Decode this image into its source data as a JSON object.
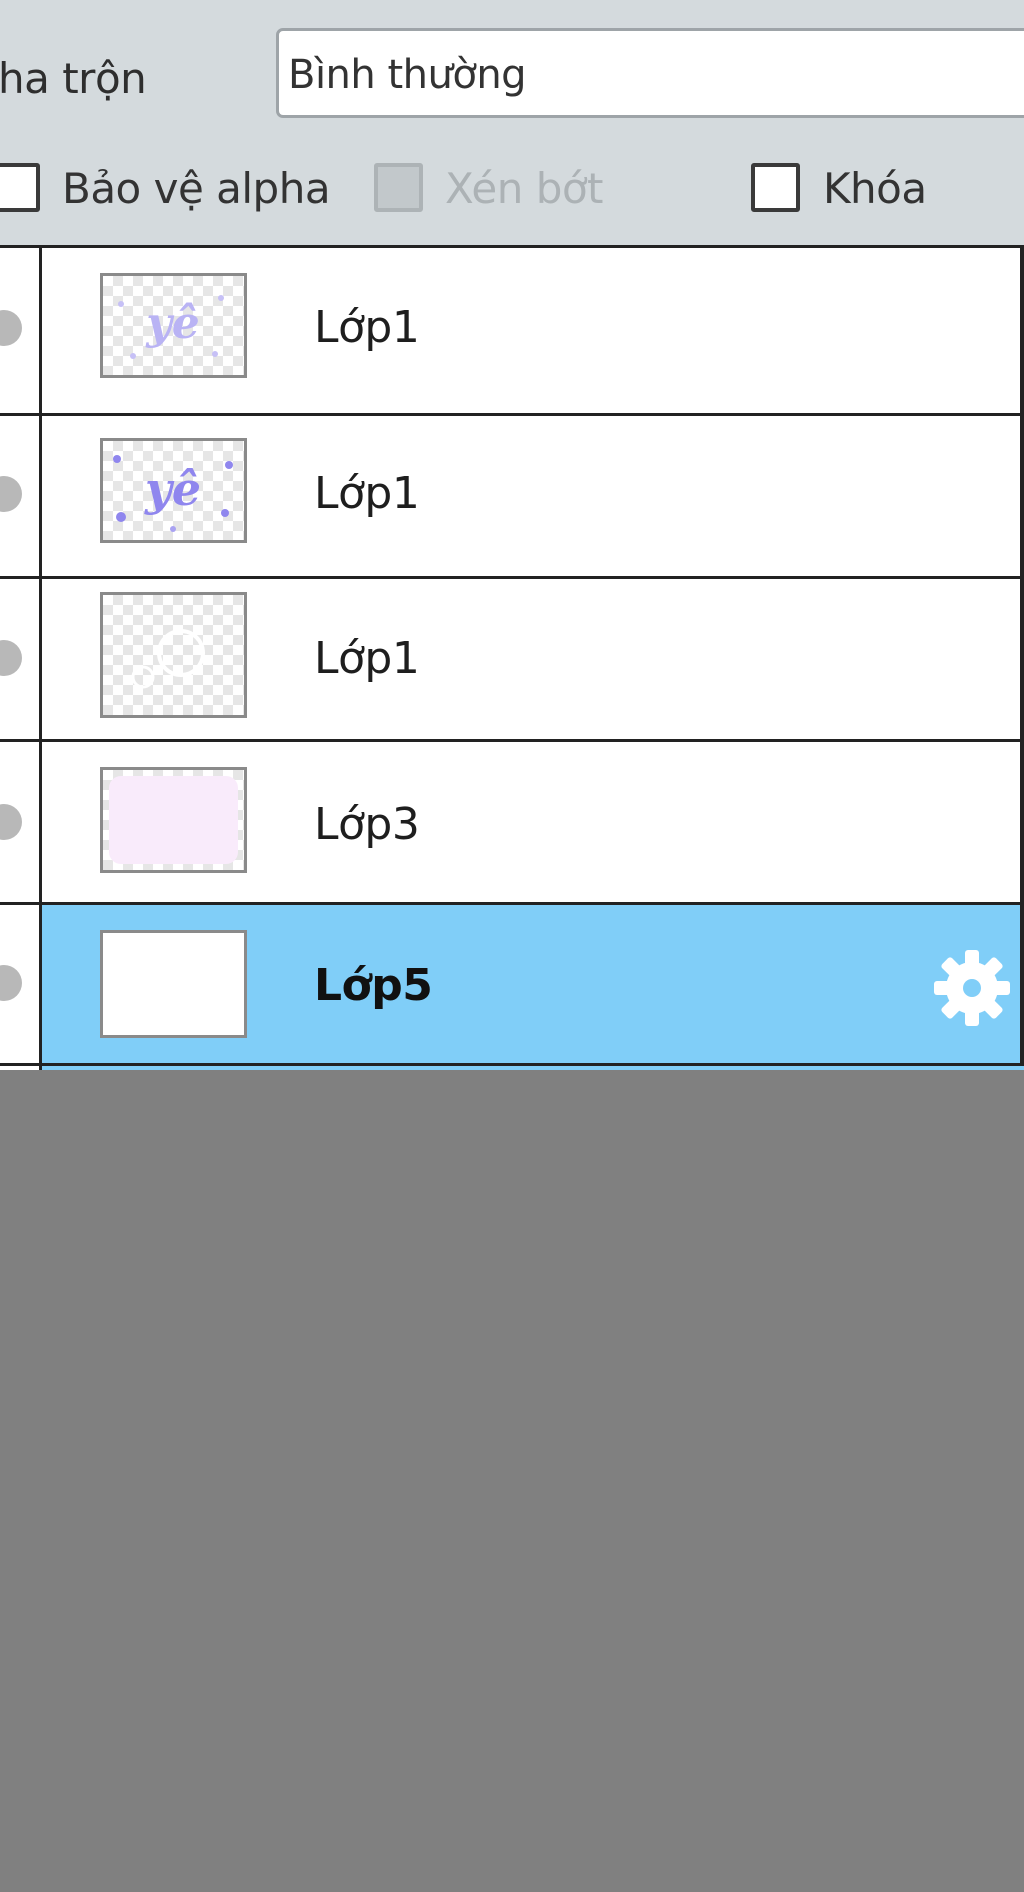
{
  "options": {
    "blend_label": "ha trộn",
    "blend_value": "Bình thường",
    "checkboxes": [
      {
        "label": "Bảo vệ alpha",
        "checked": false,
        "enabled": true
      },
      {
        "label": "Xén bớt",
        "checked": false,
        "enabled": false
      },
      {
        "label": "Khóa",
        "checked": false,
        "enabled": true
      }
    ]
  },
  "layers": [
    {
      "name": "Lớp1",
      "selected": false,
      "thumbnail_text": "yê"
    },
    {
      "name": "Lớp1",
      "selected": false,
      "thumbnail_text": "yê"
    },
    {
      "name": "Lớp1",
      "selected": false,
      "thumbnail_text": ""
    },
    {
      "name": "Lớp3",
      "selected": false,
      "thumbnail_text": ""
    },
    {
      "name": "Lớp5",
      "selected": true,
      "thumbnail_text": ""
    }
  ],
  "colors": {
    "selected_row": "#80cef8",
    "panel_bg": "#d4dadd",
    "empty_area": "#808080",
    "thumb_text": "#8f86ee"
  },
  "icons": [
    "checkbox-icon",
    "eye-icon",
    "gear-icon"
  ]
}
